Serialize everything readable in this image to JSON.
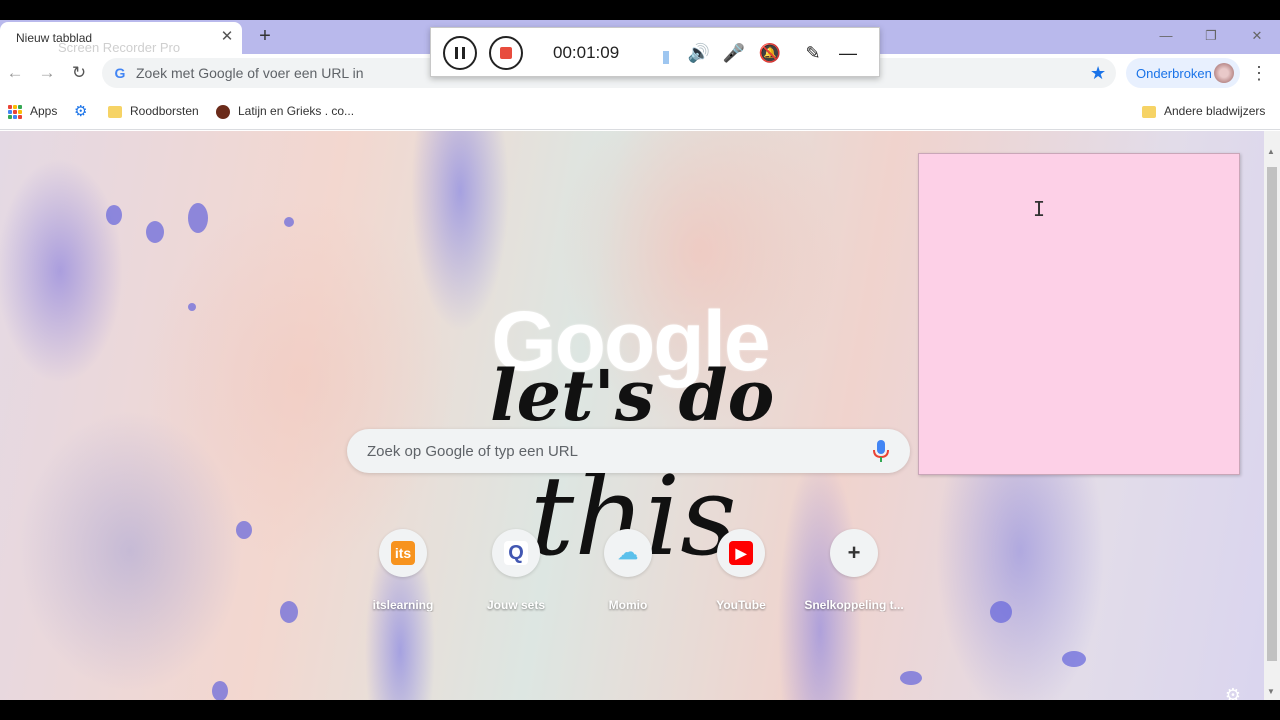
{
  "tab": {
    "title": "Nieuw tabblad",
    "watermark": "Screen Recorder Pro",
    "close": "✕",
    "new_tab": "+"
  },
  "window_controls": {
    "minimize": "—",
    "restore": "❐",
    "close": "✕"
  },
  "toolbar": {
    "back": "←",
    "forward": "→",
    "reload": "↻",
    "omnibox_placeholder": "Zoek met Google of voer een URL in",
    "g_icon": "G",
    "star": "★",
    "profile_label": "Onderbroken",
    "menu": "⋮"
  },
  "bookmarks": {
    "items": [
      {
        "label": "Apps",
        "icon": "apps-grid-icon"
      },
      {
        "label": "",
        "icon": "gear-icon"
      },
      {
        "label": "Roodborsten",
        "icon": "folder-icon"
      },
      {
        "label": "Latijn en Grieks . co...",
        "icon": "site-icon"
      }
    ],
    "other": "Andere bladwijzers"
  },
  "ntp": {
    "logo": "Google",
    "lettering_top": "let's do",
    "lettering_bottom": "this",
    "search_placeholder": "Zoek op Google of typ een URL",
    "shortcuts": [
      {
        "label": "itslearning",
        "glyph": "its",
        "color": "#f7931e"
      },
      {
        "label": "Jouw sets",
        "glyph": "Q",
        "color": "#4257b2"
      },
      {
        "label": "Momio",
        "glyph": "☁",
        "color": "#5bc0eb"
      },
      {
        "label": "YouTube",
        "glyph": "▶",
        "color": "#ff0000"
      },
      {
        "label": "Snelkoppeling t...",
        "glyph": "+",
        "color": "#f1f3f4"
      }
    ]
  },
  "recorder": {
    "timer": "00:01:09",
    "speaker": "🔊",
    "mic_muted": "🎤",
    "cam_muted": "🔕",
    "pen": "✎",
    "minimize": "—"
  },
  "sticky_note": {
    "cursor": "I"
  },
  "colors": {
    "tabstrip": "#b9b9ec",
    "sticky": "#fdd0e7",
    "accent": "#1a73e8",
    "stop": "#e84c3d"
  }
}
